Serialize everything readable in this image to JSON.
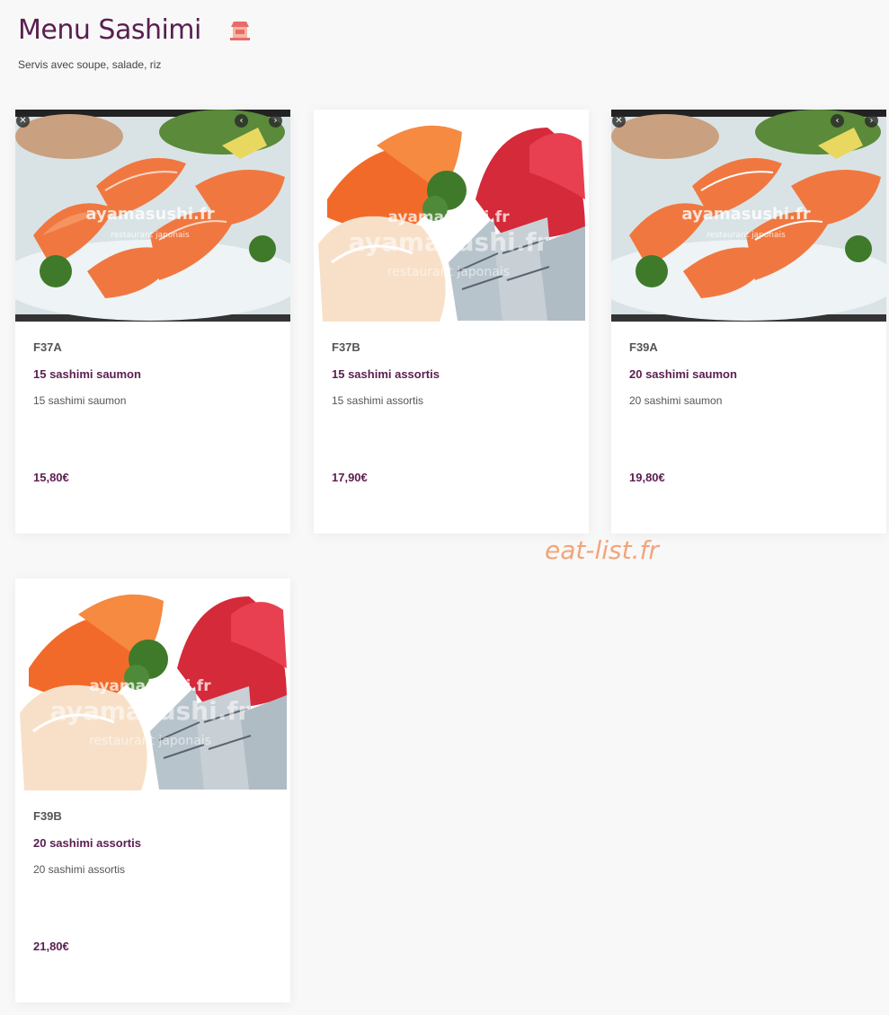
{
  "header": {
    "title": "Menu Sashimi",
    "subtitle": "Servis avec soupe, salade, riz",
    "icon": "shop-icon"
  },
  "items": [
    {
      "code": "F37A",
      "name": "15 sashimi saumon",
      "description": "15 sashimi saumon",
      "price": "15,80€",
      "image": "salmon-sashimi",
      "has_gallery_controls": true
    },
    {
      "code": "F37B",
      "name": "15 sashimi assortis",
      "description": "15 sashimi assortis",
      "price": "17,90€",
      "image": "assorted-sashimi",
      "has_gallery_controls": false
    },
    {
      "code": "F39A",
      "name": "20 sashimi saumon",
      "description": "20 sashimi saumon",
      "price": "19,80€",
      "image": "salmon-sashimi",
      "has_gallery_controls": true
    },
    {
      "code": "F39B",
      "name": "20 sashimi assortis",
      "description": "20 sashimi assortis",
      "price": "21,80€",
      "image": "assorted-sashimi",
      "has_gallery_controls": false
    }
  ],
  "photo_watermark": {
    "line1": "ayamasushi.fr",
    "line2": "restaurant japonais"
  },
  "watermark": "eat-list.fr",
  "colors": {
    "accent": "#5a1e4f",
    "background": "#f8f8f8",
    "watermark": "#f2a57a"
  }
}
